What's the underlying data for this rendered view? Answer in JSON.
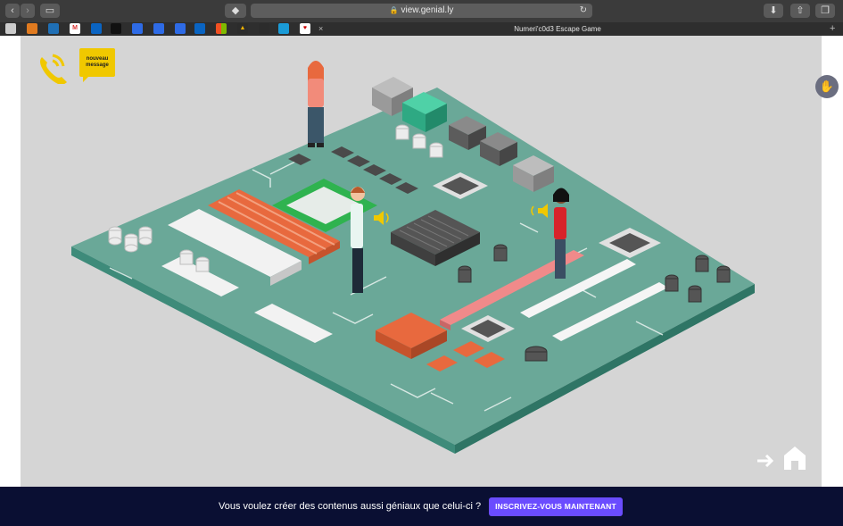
{
  "browser": {
    "url": "view.genial.ly",
    "tab_title": "Numeri'c0d3 Escape Game",
    "tab_close": "×",
    "new_tab": "+"
  },
  "stage": {
    "notification_label": "nouveau message",
    "icons": [
      "phone-icon",
      "speaker-icon",
      "home-icon",
      "arrow-right-icon",
      "hand-icon",
      "more-icon"
    ]
  },
  "promo": {
    "text": "Vous voulez créer des contenus aussi géniaux que celui-ci ?",
    "button": "INSCRIVEZ-VOUS MAINTENANT"
  },
  "colors": {
    "board": "#5e9e8e",
    "accent_orange": "#e8693e",
    "accent_yellow": "#f0c800",
    "promo_bar": "#0a0f33",
    "promo_button": "#6a4cff"
  }
}
